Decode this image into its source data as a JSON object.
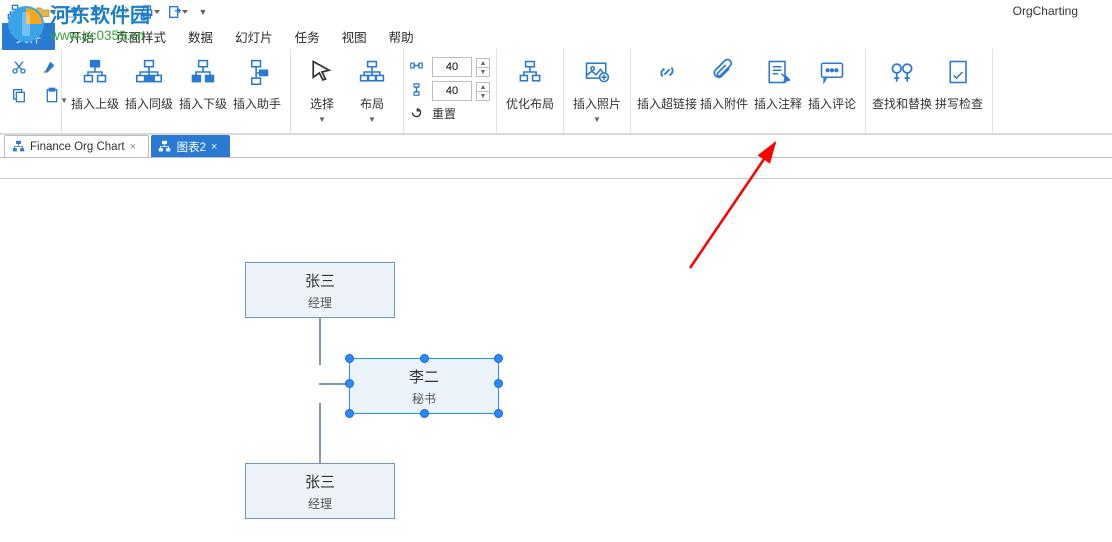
{
  "app": {
    "title": "OrgCharting"
  },
  "watermark": {
    "line1": "河东软件园",
    "line2": "www.pc0359.cn"
  },
  "menu": {
    "file": "文件",
    "items": [
      "开始",
      "页面样式",
      "数据",
      "幻灯片",
      "任务",
      "视图",
      "帮助"
    ]
  },
  "ribbon": {
    "insert_parent": "插入上级",
    "insert_sibling": "插入同级",
    "insert_child": "插入下级",
    "insert_assistant": "插入助手",
    "select": "选择",
    "layout": "布局",
    "h_spacing": "40",
    "v_spacing": "40",
    "reset": "重置",
    "optimize_layout": "优化布局",
    "insert_image": "插入照片",
    "insert_hyperlink": "插入超链接",
    "insert_attachment": "插入附件",
    "insert_note": "插入注释",
    "insert_comment": "插入评论",
    "find_replace": "查找和替换",
    "spell_check": "拼写检查"
  },
  "tabs": {
    "t1": "Finance Org Chart",
    "t2": "图表2"
  },
  "nodes": {
    "n1": {
      "name": "张三",
      "role": "经理"
    },
    "n2": {
      "name": "李二",
      "role": "秘书"
    },
    "n3": {
      "name": "张三",
      "role": "经理"
    }
  }
}
